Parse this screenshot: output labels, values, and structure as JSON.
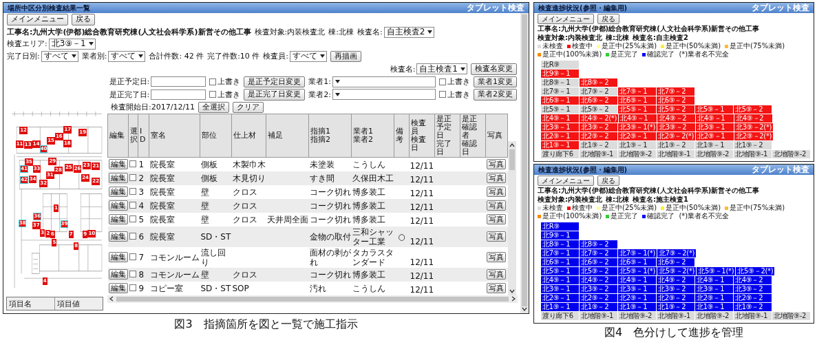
{
  "figure3": {
    "window": {
      "title": "場所中区分別検査結果一覧",
      "mode": "タブレット検査"
    },
    "nav_buttons": [
      "メインメニュー",
      "戻る"
    ],
    "info_row": [
      {
        "kind": "text",
        "text": "工事名:九州大学(伊都)総合教育研究棟(人文社会科学系)新営その他工事"
      },
      {
        "kind": "text",
        "text": "検査対象:内装検査北"
      },
      {
        "kind": "text",
        "text": "棟:北棟"
      },
      {
        "kind": "select",
        "label": "検査名:",
        "value": "自主検査2"
      },
      {
        "kind": "select",
        "label": "検査エリア:",
        "value": "北3⑨－1"
      }
    ],
    "filter_row": [
      {
        "kind": "select",
        "label": "完了日別:",
        "value": "すべて"
      },
      {
        "kind": "select",
        "label": "業者別:",
        "value": "すべて"
      },
      {
        "kind": "text",
        "text": "合計件数: 42 件"
      },
      {
        "kind": "text",
        "text": "完了件数:10 件"
      },
      {
        "kind": "select",
        "label": "検査員:",
        "value": "すべて"
      },
      {
        "kind": "button",
        "text": "再描画"
      }
    ],
    "form_rows": [
      [
        {
          "kind": "select",
          "label": "検査名:",
          "value": "自主検査1"
        },
        {
          "kind": "button",
          "text": "検査名変更"
        }
      ],
      [
        {
          "kind": "date",
          "label": "是正予定日:"
        },
        {
          "kind": "checkbox",
          "label": "上書き",
          "checked": false
        },
        {
          "kind": "button",
          "text": "是正予定日変更"
        },
        {
          "kind": "select",
          "label": "業者1:"
        },
        {
          "kind": "checkbox",
          "label": "上書き",
          "checked": false
        },
        {
          "kind": "button",
          "text": "業者1変更"
        }
      ],
      [
        {
          "kind": "date",
          "label": "是正完了日:"
        },
        {
          "kind": "checkbox",
          "label": "上書き",
          "checked": false
        },
        {
          "kind": "button",
          "text": "是正完了日変更"
        },
        {
          "kind": "select",
          "label": "業者2:"
        },
        {
          "kind": "checkbox",
          "label": "上書き",
          "checked": false
        },
        {
          "kind": "button",
          "text": "業者2変更"
        }
      ]
    ],
    "plan": {
      "markers": [
        {
          "label": "12",
          "highlighted": false
        },
        {
          "label": "11",
          "highlighted": false
        },
        {
          "label": "13",
          "highlighted": false
        },
        {
          "label": "14",
          "highlighted": false
        },
        {
          "label": "40",
          "highlighted": true
        },
        {
          "label": "15",
          "highlighted": false
        },
        {
          "label": "16",
          "highlighted": false
        },
        {
          "label": "17",
          "highlighted": false
        },
        {
          "label": "18",
          "highlighted": false
        },
        {
          "label": "19",
          "highlighted": false
        },
        {
          "label": "35",
          "highlighted": false
        },
        {
          "label": "41",
          "highlighted": true
        },
        {
          "label": "33",
          "highlighted": false
        },
        {
          "label": "42",
          "highlighted": true
        },
        {
          "label": "34",
          "highlighted": false
        },
        {
          "label": "29",
          "highlighted": false
        },
        {
          "label": "28",
          "highlighted": false
        },
        {
          "label": "31",
          "highlighted": false
        },
        {
          "label": "32",
          "highlighted": false
        },
        {
          "label": "25",
          "highlighted": false
        },
        {
          "label": "26",
          "highlighted": false
        },
        {
          "label": "23",
          "highlighted": false
        },
        {
          "label": "21",
          "highlighted": false
        },
        {
          "label": "24",
          "highlighted": false
        },
        {
          "label": "22",
          "highlighted": false
        },
        {
          "label": "1",
          "highlighted": false
        },
        {
          "label": "36",
          "highlighted": true
        },
        {
          "label": "37",
          "highlighted": false
        },
        {
          "label": "38",
          "highlighted": true
        },
        {
          "label": "39",
          "highlighted": true
        },
        {
          "label": "3",
          "highlighted": false
        },
        {
          "label": "2",
          "highlighted": false
        },
        {
          "label": "6",
          "highlighted": false
        },
        {
          "label": "5",
          "highlighted": false
        },
        {
          "label": "7",
          "highlighted": false
        },
        {
          "label": "9",
          "highlighted": false
        },
        {
          "label": "10",
          "highlighted": false
        },
        {
          "label": "8",
          "highlighted": false
        },
        {
          "label": "4",
          "highlighted": false
        }
      ],
      "item_table": [
        "項目名",
        "項目値"
      ]
    },
    "table": {
      "start_label": "検査開始日:2017/12/11",
      "buttons": [
        "全選択",
        "クリア"
      ],
      "columns": [
        [
          "編集"
        ],
        [
          "選択"
        ],
        [
          "ID"
        ],
        [
          "室名"
        ],
        [
          "部位"
        ],
        [
          "仕上材"
        ],
        [
          "補足"
        ],
        [
          "指摘1",
          "指摘2"
        ],
        [
          "業者1",
          "業者2"
        ],
        [
          "備考"
        ],
        [
          "検査員",
          "検査日"
        ],
        [
          "是正",
          "予定日",
          "完了日"
        ],
        [
          "是正",
          "確認者",
          "確認日"
        ],
        [
          "写真"
        ]
      ],
      "rows": [
        {
          "edit": "編集",
          "checked": false,
          "id": "1",
          "room": "院長室",
          "part": "側板",
          "material": "木製巾木",
          "issue": "未塗装",
          "contractor": "こうしん",
          "date": "12/11",
          "photo": "写真"
        },
        {
          "edit": "編集",
          "checked": false,
          "id": "2",
          "room": "院長室",
          "part": "側板",
          "material": "木見切り",
          "issue": "すき間",
          "contractor": "久保田木工",
          "date": "12/11",
          "photo": "写真"
        },
        {
          "edit": "編集",
          "checked": false,
          "id": "3",
          "room": "院長室",
          "part": "壁",
          "material": "クロス",
          "issue": "コーク切れ",
          "contractor": "博多装工",
          "date": "12/11",
          "photo": "写真"
        },
        {
          "edit": "編集",
          "checked": false,
          "id": "4",
          "room": "院長室",
          "part": "壁",
          "material": "クロス",
          "issue": "コーク切れ",
          "contractor": "博多装工",
          "date": "12/11",
          "photo": "写真"
        },
        {
          "edit": "編集",
          "checked": false,
          "id": "5",
          "room": "院長室",
          "part": "壁",
          "material": "クロス",
          "supplement": "天井周全面",
          "issue": "コーク切れ",
          "contractor": "博多装工",
          "date": "12/11",
          "photo": "写真"
        },
        {
          "edit": "編集",
          "checked": false,
          "id": "6",
          "room": "院長室",
          "part": "SD・ST",
          "issue": "金物の取付",
          "contractor": "三和シャッター工業",
          "remark": "○",
          "date": "12/11",
          "photo": "写真"
        },
        {
          "edit": "編集",
          "checked": false,
          "id": "7",
          "room": "コモンルーム",
          "part": "流し回り",
          "issue": "面材の剥がれ",
          "contractor": "タカラスタンダード",
          "date": "12/11",
          "photo": "写真"
        },
        {
          "edit": "編集",
          "checked": false,
          "id": "8",
          "room": "コモンルーム",
          "part": "壁",
          "material": "クロス",
          "issue": "コーク切れ",
          "contractor": "博多装工",
          "date": "12/11",
          "photo": "写真"
        },
        {
          "edit": "編集",
          "checked": false,
          "id": "9",
          "room": "コピー室",
          "part": "SD・ST",
          "material": "SOP",
          "issue": "汚れ",
          "contractor": "こうしん",
          "date": "12/11",
          "photo": "写真"
        }
      ]
    },
    "caption": "図3　指摘箇所を図と一覧で施工指示"
  },
  "figure4": {
    "panels": [
      {
        "window": {
          "title": "検査進捗状況(参照・編集用)",
          "mode": "タブレット検査"
        },
        "nav_buttons": [
          "メインメニュー",
          "戻る"
        ],
        "info": [
          "工事名:九州大学(伊都)総合教育研究棟(人文社会科学系)新営その他工事",
          "検査対象:内装検査北",
          "棟:北棟",
          "検査名:自主検査2"
        ],
        "legend": [
          {
            "label": "未検査",
            "color": "#dddddd"
          },
          {
            "label": "検査中",
            "color": "#ff0000"
          },
          {
            "label": "是正中(25%未満)",
            "color": "#ffff99"
          },
          {
            "label": "是正中(50%未満)",
            "color": "#ffee33"
          },
          {
            "label": "是正中(75%未満)",
            "color": "#ffbb33"
          },
          {
            "label": "是正中(100%未満)",
            "color": "#ff8800"
          },
          {
            "label": "是正完了",
            "color": "#33cc33"
          },
          {
            "label": "確認完了",
            "color": "#0000ff"
          },
          {
            "label": "(*)業者名不完全"
          }
        ],
        "grid": [
          [
            {
              "label": "北R⑨",
              "color": "#dcdcdc"
            }
          ],
          [
            {
              "label": "北9⑨－1",
              "color": "#f41414"
            }
          ],
          [
            {
              "label": "北8⑨－1",
              "color": "#dcdcdc"
            },
            {
              "label": "北8⑨－2",
              "color": "#f41414"
            }
          ],
          [
            {
              "label": "北7⑨－1",
              "color": "#dcdcdc"
            },
            {
              "label": "北7⑨－2",
              "color": "#dcdcdc"
            },
            {
              "label": "北7⑨－1",
              "color": "#f41414"
            },
            {
              "label": "北7⑨－2",
              "color": "#f41414"
            }
          ],
          [
            {
              "label": "北6⑨－1",
              "color": "#f41414"
            },
            {
              "label": "北6⑨－2",
              "color": "#f41414"
            },
            {
              "label": "北6⑨－1",
              "color": "#f41414"
            },
            {
              "label": "北6⑨－2",
              "color": "#f41414"
            }
          ],
          [
            {
              "label": "北5⑨－1",
              "color": "#dcdcdc"
            },
            {
              "label": "北5⑨－2",
              "color": "#dcdcdc"
            },
            {
              "label": "北5⑨－1",
              "color": "#f41414"
            },
            {
              "label": "北5⑨－2",
              "color": "#f41414"
            },
            {
              "label": "北5⑨－1",
              "color": "#f41414"
            },
            {
              "label": "北5⑨－2",
              "color": "#f41414"
            }
          ],
          [
            {
              "label": "北4⑨－1",
              "color": "#f41414"
            },
            {
              "label": "北4⑨－2(*)",
              "color": "#f41414"
            },
            {
              "label": "北4⑨－1",
              "color": "#f41414"
            },
            {
              "label": "北4⑨－2",
              "color": "#f41414"
            },
            {
              "label": "北4⑨－1",
              "color": "#f41414"
            },
            {
              "label": "北4⑨－2",
              "color": "#f41414"
            }
          ],
          [
            {
              "label": "北3⑨－1",
              "color": "#f41414"
            },
            {
              "label": "北3⑨－2",
              "color": "#f41414"
            },
            {
              "label": "北3⑨－1(*)",
              "color": "#f41414"
            },
            {
              "label": "北3⑨－2",
              "color": "#f41414"
            },
            {
              "label": "北3⑨－1",
              "color": "#f41414"
            },
            {
              "label": "北3⑨－2(*)",
              "color": "#f41414"
            }
          ],
          [
            {
              "label": "北2⑨－1",
              "color": "#f41414"
            },
            {
              "label": "北2⑨－2",
              "color": "#f41414"
            },
            {
              "label": "北2⑨－1",
              "color": "#f41414"
            },
            {
              "label": "北2⑨－2(*)",
              "color": "#f41414"
            },
            {
              "label": "北2⑨－1",
              "color": "#f41414"
            },
            {
              "label": "北2⑨－2(*)",
              "color": "#f41414"
            }
          ],
          [
            {
              "label": "北1⑨－1",
              "color": "#f41414"
            },
            {
              "label": "北1⑨－2",
              "color": "#dcdcdc"
            },
            {
              "label": "北1⑨－1",
              "color": "#dcdcdc"
            },
            {
              "label": "北1⑨－2",
              "color": "#dcdcdc"
            },
            {
              "label": "北1⑨－1",
              "color": "#dcdcdc"
            },
            {
              "label": "北1⑨－2",
              "color": "#dcdcdc"
            }
          ],
          [
            {
              "label": "渡り廊下6",
              "color": "#dcdcdc"
            },
            {
              "label": "北地階⑨-1",
              "color": "#dcdcdc"
            },
            {
              "label": "北地階⑨-2",
              "color": "#dcdcdc"
            },
            {
              "label": "北地階⑨-1",
              "color": "#dcdcdc"
            },
            {
              "label": "北地階⑨-2",
              "color": "#dcdcdc"
            },
            {
              "label": "北地階⑨-1",
              "color": "#dcdcdc"
            },
            {
              "label": "北地階⑨-2",
              "color": "#dcdcdc"
            }
          ]
        ]
      },
      {
        "window": {
          "title": "検査進捗状況(参照・編集用)",
          "mode": "タブレット検査"
        },
        "nav_buttons": [
          "メインメニュー",
          "戻る"
        ],
        "info": [
          "工事名:九州大学(伊都)総合教育研究棟(人文社会科学系)新営その他工事",
          "検査対象:内装検査北",
          "棟:北棟",
          "検査名:施主検査1"
        ],
        "legend": [
          {
            "label": "未検査",
            "color": "#dddddd"
          },
          {
            "label": "検査中",
            "color": "#ff0000"
          },
          {
            "label": "是正中(25%未満)",
            "color": "#ffff99"
          },
          {
            "label": "是正中(50%未満)",
            "color": "#ffee33"
          },
          {
            "label": "是正中(75%未満)",
            "color": "#ffbb33"
          },
          {
            "label": "是正中(100%未満)",
            "color": "#ff8800"
          },
          {
            "label": "是正完了",
            "color": "#33cc33"
          },
          {
            "label": "確認完了",
            "color": "#0000ff"
          },
          {
            "label": "(*)業者名不完全"
          }
        ],
        "grid": [
          [
            {
              "label": "北R⑨",
              "color": "#0000ee"
            }
          ],
          [
            {
              "label": "北9⑨－1",
              "color": "#0000ee"
            }
          ],
          [
            {
              "label": "北8⑨－1",
              "color": "#0000ee"
            },
            {
              "label": "北8⑨－2",
              "color": "#0000ee"
            }
          ],
          [
            {
              "label": "北7⑨－1",
              "color": "#0000ee"
            },
            {
              "label": "北7⑨－2",
              "color": "#0000ee"
            },
            {
              "label": "北7⑨－1(*)",
              "color": "#0000ee"
            },
            {
              "label": "北7⑨－2(*)",
              "color": "#0000ee"
            }
          ],
          [
            {
              "label": "北6⑨－1",
              "color": "#0000ee"
            },
            {
              "label": "北6⑨－2",
              "color": "#0000ee"
            },
            {
              "label": "北6⑨－1",
              "color": "#0000ee"
            },
            {
              "label": "北6⑨－2",
              "color": "#0000ee"
            }
          ],
          [
            {
              "label": "北5⑨－1",
              "color": "#0000ee"
            },
            {
              "label": "北5⑨－2",
              "color": "#0000ee"
            },
            {
              "label": "北5⑨－1(*)",
              "color": "#0000ee"
            },
            {
              "label": "北5⑨－2(*)",
              "color": "#0000ee"
            },
            {
              "label": "北5⑨－1(*)",
              "color": "#0000ee"
            },
            {
              "label": "北5⑨－2(*)",
              "color": "#0000ee"
            }
          ],
          [
            {
              "label": "北4⑨－1",
              "color": "#0000ee"
            },
            {
              "label": "北4⑨－2",
              "color": "#0000ee"
            },
            {
              "label": "北4⑨－1",
              "color": "#0000ee"
            },
            {
              "label": "北4⑨－2",
              "color": "#0000ee"
            },
            {
              "label": "北4⑨－1",
              "color": "#0000ee"
            },
            {
              "label": "北4⑨－2",
              "color": "#0000ee"
            }
          ],
          [
            {
              "label": "北3⑨－1",
              "color": "#0000ee"
            },
            {
              "label": "北3⑨－2",
              "color": "#0000ee"
            },
            {
              "label": "北3⑨－1",
              "color": "#0000ee"
            },
            {
              "label": "北3⑨－2",
              "color": "#0000ee"
            },
            {
              "label": "北3⑨－1",
              "color": "#0000ee"
            },
            {
              "label": "北3⑨－2",
              "color": "#0000ee"
            }
          ],
          [
            {
              "label": "北2⑨－1",
              "color": "#0000ee"
            },
            {
              "label": "北2⑨－2",
              "color": "#0000ee"
            },
            {
              "label": "北2⑨－1",
              "color": "#0000ee"
            },
            {
              "label": "北2⑨－2",
              "color": "#0000ee"
            },
            {
              "label": "北2⑨－1",
              "color": "#0000ee"
            },
            {
              "label": "北2⑨－2",
              "color": "#0000ee"
            }
          ],
          [
            {
              "label": "北1⑨－1",
              "color": "#0000ee"
            },
            {
              "label": "北1⑨－2",
              "color": "#0000ee"
            },
            {
              "label": "北1⑨－1",
              "color": "#0000ee"
            },
            {
              "label": "北1⑨－2",
              "color": "#0000ee"
            },
            {
              "label": "北1⑨－1",
              "color": "#0000ee"
            },
            {
              "label": "北1⑨－2",
              "color": "#0000ee"
            }
          ],
          [
            {
              "label": "渡り廊下6",
              "color": "#dcdcdc"
            },
            {
              "label": "北地階⑨-1",
              "color": "#dcdcdc"
            },
            {
              "label": "北地階⑨-2",
              "color": "#dcdcdc"
            },
            {
              "label": "北地階⑨-1",
              "color": "#dcdcdc"
            },
            {
              "label": "北地階⑨-2",
              "color": "#dcdcdc"
            },
            {
              "label": "北地階⑨-1",
              "color": "#dcdcdc"
            },
            {
              "label": "北地階⑨-2",
              "color": "#dcdcdc"
            }
          ]
        ]
      }
    ],
    "caption": "図4　色分けして進捗を管理"
  }
}
